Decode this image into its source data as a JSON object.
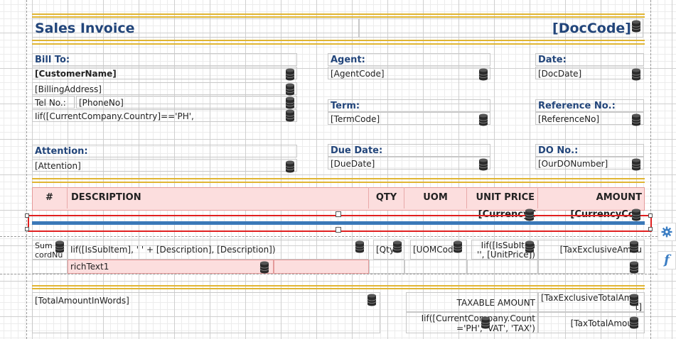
{
  "report": {
    "title": "Sales Invoice",
    "doc_code": "[DocCode]"
  },
  "bill_to": {
    "label": "Bill To:",
    "customer_name": "[CustomerName]",
    "billing_address": "[BillingAddress]",
    "tel_label": "Tel No.:",
    "phone": "[PhoneNo]",
    "country_expr": "Iif([CurrentCompany.Country]=='PH',"
  },
  "agent": {
    "label": "Agent:",
    "value": "[AgentCode]"
  },
  "date": {
    "label": "Date:",
    "value": "[DocDate]"
  },
  "term": {
    "label": "Term:",
    "value": "[TermCode]"
  },
  "reference": {
    "label": "Reference No.:",
    "value": "[ReferenceNo]"
  },
  "attention": {
    "label": "Attention:",
    "value": "[Attention]"
  },
  "due_date": {
    "label": "Due Date:",
    "value": "[DueDate]"
  },
  "do_no": {
    "label": "DO No.:",
    "value": "[OurDONumber]"
  },
  "table_header": {
    "num": "#",
    "description": "DESCRIPTION",
    "qty": "QTY",
    "uom": "UOM",
    "unit_price": "UNIT PRICE",
    "amount": "AMOUNT",
    "currency_1": "[CurrencyC",
    "currency_2": "[CurrencyCod"
  },
  "detail": {
    "sum_line1": "Sum",
    "sum_line2": "cordNu",
    "description_expr": "Iif([IsSubItem], '    ' + [Description], [Description])",
    "qty": "[Qty",
    "uom": "[UOMCode",
    "unit_price_line1": "Iif([IsSubIten",
    "unit_price_line2": "'', [UnitPrice])",
    "amount": "[TaxExclusiveAmou",
    "rich_text": "richText1"
  },
  "footer": {
    "amount_in_words": "[TotalAmountInWords]",
    "taxable_amount_label": "TAXABLE AMOUNT",
    "tax_exclusive_total": "[TaxExclusiveTotalAmo",
    "tax_exclusive_total_tail": "t]",
    "tax_label_line1": "Iif([CurrentCompany.Count",
    "tax_label_line2": "='PH', 'VAT', 'TAX')",
    "tax_total": "[TaxTotalAmou"
  },
  "side_panel": {
    "properties_icon": "gear-icon",
    "expressions_icon": "function-icon",
    "expressions_glyph": "f"
  },
  "colors": {
    "title_blue": "#22457a",
    "gold_rule": "#e0b533",
    "header_band": "#fcdede",
    "selection_red": "#e02020",
    "accent_blue": "#3a78b8"
  }
}
